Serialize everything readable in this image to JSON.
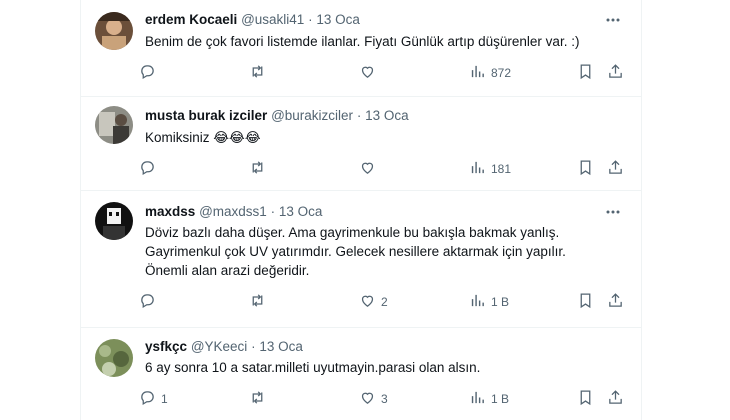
{
  "tweets": [
    {
      "name": "erdem Kocaeli",
      "handle": "@usakli41",
      "dot": "·",
      "date": "13 Oca",
      "text": "Benim de çok favori listemde ilanlar. Fiyatı Günlük artıp düşürenler var. :)",
      "replies": "",
      "retweets": "",
      "likes": "",
      "views": "872"
    },
    {
      "name": "musta burak izciler",
      "handle": "@burakizciler",
      "dot": "·",
      "date": "13 Oca",
      "text": "Komiksiniz 😂😂😂",
      "replies": "",
      "retweets": "",
      "likes": "",
      "views": "181"
    },
    {
      "name": "maxdss",
      "handle": "@maxdss1",
      "dot": "·",
      "date": "13 Oca",
      "text": "Döviz bazlı daha düşer. Ama gayrimenkule bu bakışla bakmak yanlış.\nGayrimenkul çok UV yatırımdır. Gelecek nesillere aktarmak için yapılır.\nÖnemli alan arazi değeridir.",
      "replies": "",
      "retweets": "",
      "likes": "2",
      "views": "1 B"
    },
    {
      "name": "ysfkçc",
      "handle": "@YKeeci",
      "dot": "·",
      "date": "13 Oca",
      "text": "6 ay sonra 10 a satar.milleti uyutmayin.parasi olan alsın.",
      "replies": "1",
      "retweets": "",
      "likes": "3",
      "views": "1 B"
    }
  ],
  "colors": {
    "text": "#0f1419",
    "secondary": "#536471",
    "border": "#eff3f4"
  },
  "icons": [
    "more-icon",
    "reply-icon",
    "retweet-icon",
    "like-icon",
    "views-icon",
    "bookmark-icon",
    "share-icon"
  ]
}
